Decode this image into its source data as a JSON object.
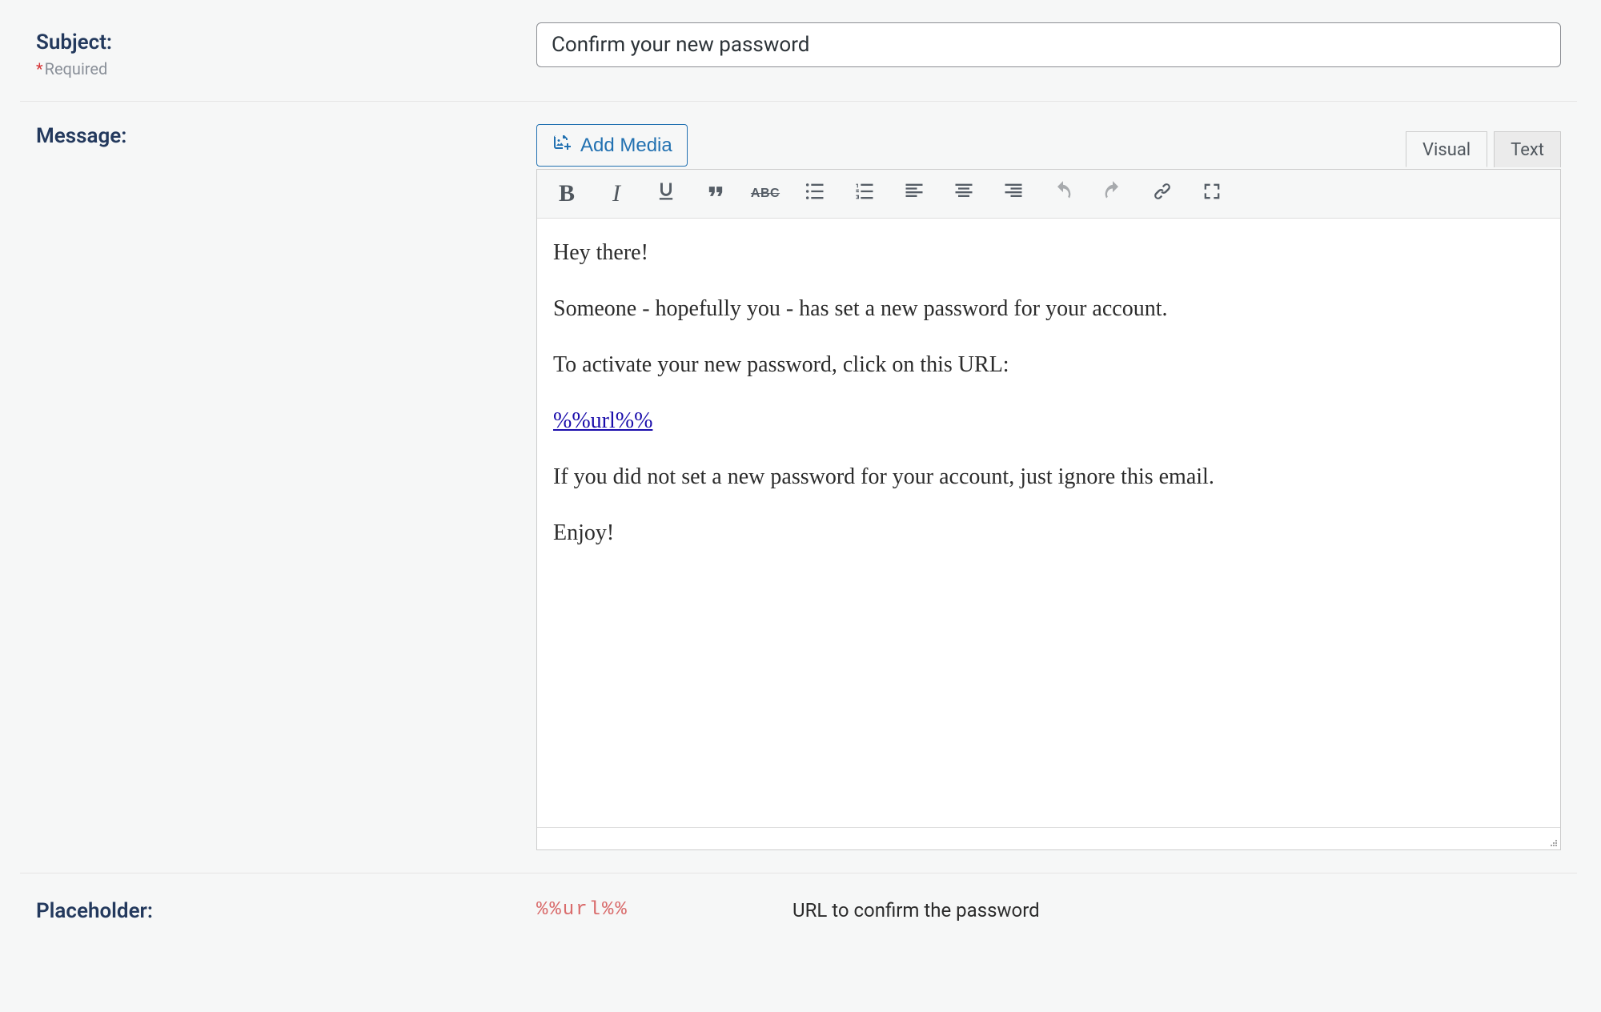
{
  "subject": {
    "label": "Subject:",
    "required": "Required",
    "value": "Confirm your new password"
  },
  "message": {
    "label": "Message:"
  },
  "editor": {
    "add_media": "Add Media",
    "tabs": {
      "visual": "Visual",
      "text": "Text"
    },
    "toolbar": {
      "bold": "B",
      "italic": "I",
      "abc": "ABC"
    },
    "body": {
      "p1": "Hey there!",
      "p2": "Someone - hopefully you - has set a new password for your account.",
      "p3": "To activate your new password, click on this URL:",
      "link": "%%url%%",
      "p4": "If you did not set a new password for your account, just ignore this email.",
      "p5": "Enjoy!"
    }
  },
  "placeholder": {
    "label": "Placeholder:",
    "token": "%%url%%",
    "desc": "URL to confirm the password"
  }
}
